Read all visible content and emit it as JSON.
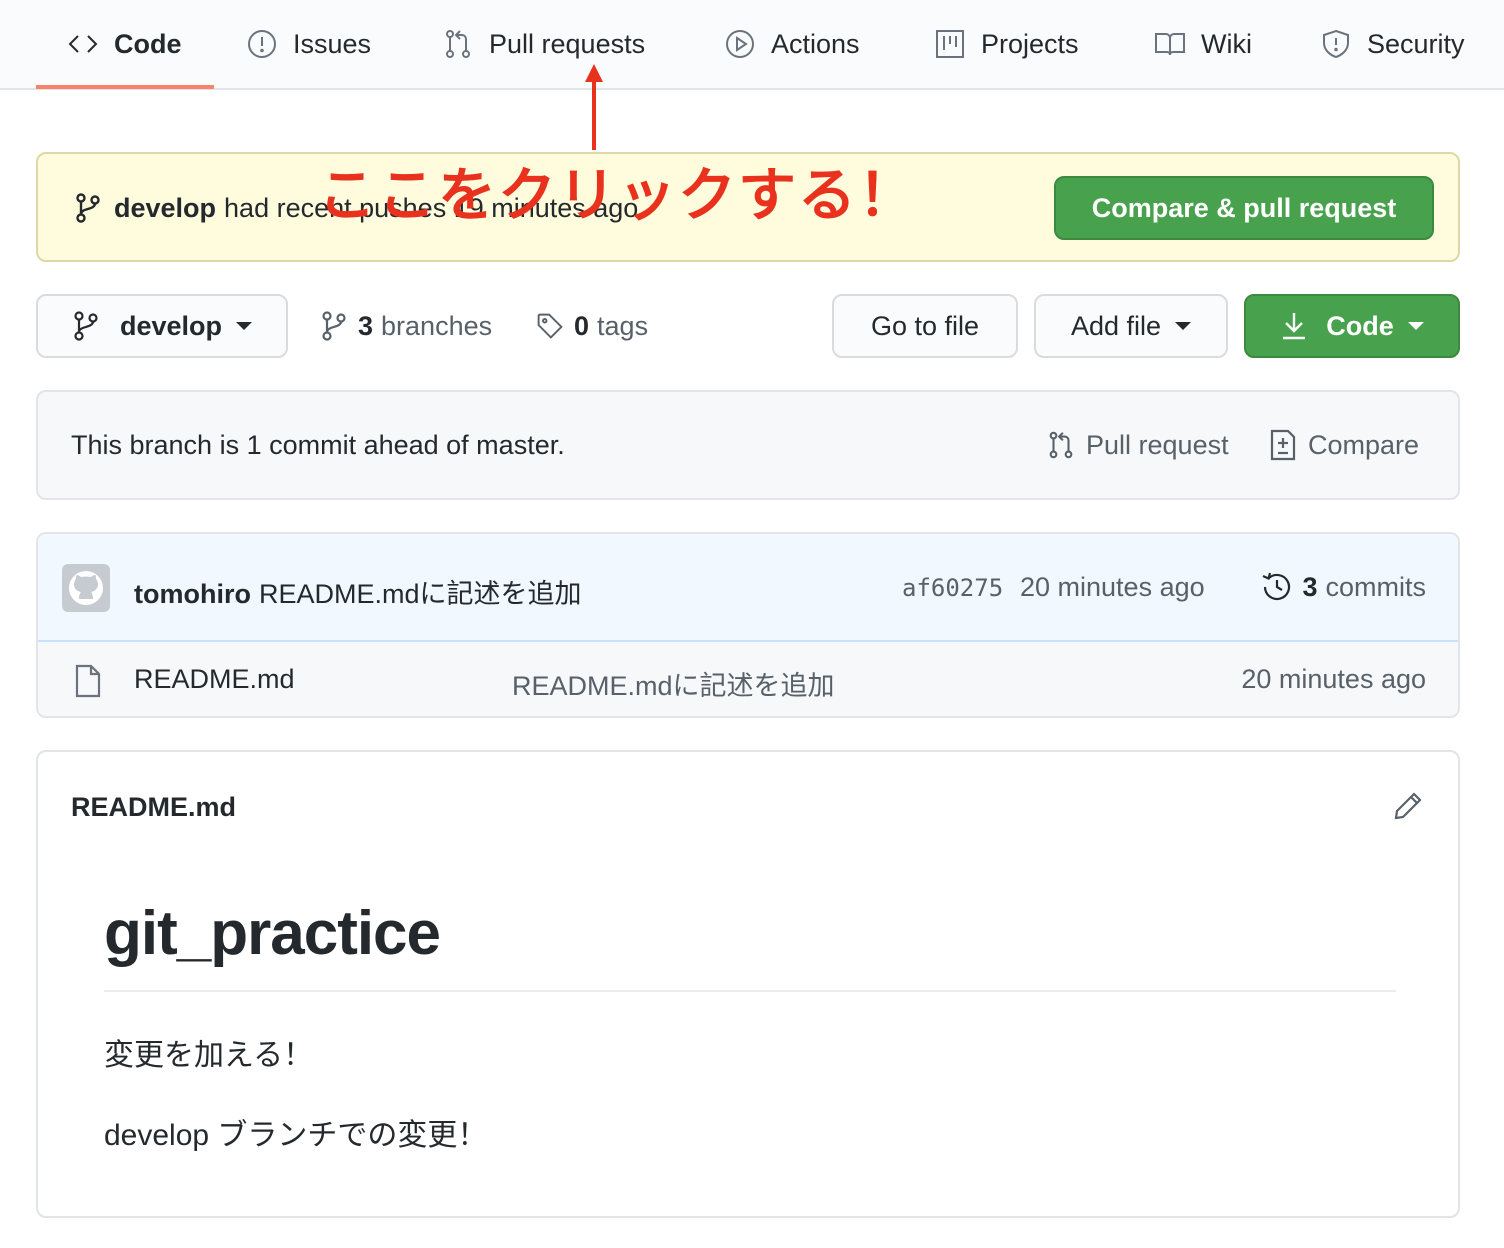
{
  "nav": {
    "tabs": [
      {
        "label": "Code",
        "icon": "code-icon",
        "active": true
      },
      {
        "label": "Issues",
        "icon": "issue-icon"
      },
      {
        "label": "Pull requests",
        "icon": "pull-request-icon"
      },
      {
        "label": "Actions",
        "icon": "play-icon"
      },
      {
        "label": "Projects",
        "icon": "project-icon"
      },
      {
        "label": "Wiki",
        "icon": "book-icon"
      },
      {
        "label": "Security",
        "icon": "shield-icon"
      }
    ]
  },
  "annotation": {
    "text": "ここをクリックする！",
    "color": "#e8321e"
  },
  "banner": {
    "branch": "develop",
    "text": "had recent pushes 19 minutes ago",
    "button": "Compare & pull request"
  },
  "toolbar": {
    "branch": "develop",
    "branches_count": "3",
    "branches_label": "branches",
    "tags_count": "0",
    "tags_label": "tags",
    "goto_file": "Go to file",
    "add_file": "Add file",
    "code": "Code"
  },
  "ahead": {
    "text": "This branch is 1 commit ahead of master.",
    "pull_request": "Pull request",
    "compare": "Compare"
  },
  "commit": {
    "author": "tomohiro",
    "message": "README.mdに記述を追加",
    "sha": "af60275",
    "time": "20 minutes ago",
    "commits_count": "3",
    "commits_label": "commits"
  },
  "files": [
    {
      "name": "README.md",
      "message": "README.mdに記述を追加",
      "time": "20 minutes ago"
    }
  ],
  "readme": {
    "filename": "README.md",
    "heading": "git_practice",
    "paragraphs": [
      "変更を加える！",
      "develop ブランチでの変更！"
    ]
  },
  "colors": {
    "accent_underline": "#f9826c",
    "green_button": "#48a14d",
    "banner_bg": "#fffbdd"
  }
}
